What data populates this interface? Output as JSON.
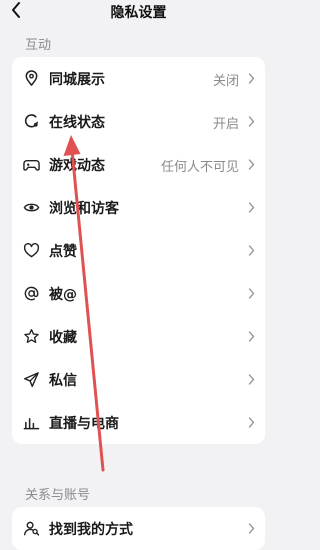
{
  "header": {
    "title": "隐私设置"
  },
  "sections": [
    {
      "title": "互动",
      "items": [
        {
          "label": "同城展示",
          "value": "关闭",
          "icon": "location-pin-icon"
        },
        {
          "label": "在线状态",
          "value": "开启",
          "icon": "online-status-icon"
        },
        {
          "label": "游戏动态",
          "value": "任何人不可见",
          "icon": "gamepad-icon"
        },
        {
          "label": "浏览和访客",
          "value": "",
          "icon": "eye-icon"
        },
        {
          "label": "点赞",
          "value": "",
          "icon": "heart-icon"
        },
        {
          "label": "被@",
          "value": "",
          "icon": "at-icon"
        },
        {
          "label": "收藏",
          "value": "",
          "icon": "star-icon"
        },
        {
          "label": "私信",
          "value": "",
          "icon": "send-icon"
        },
        {
          "label": "直播与电商",
          "value": "",
          "icon": "bar-chart-icon"
        }
      ]
    },
    {
      "title": "关系与账号",
      "items": [
        {
          "label": "找到我的方式",
          "value": "",
          "icon": "find-user-icon"
        }
      ]
    }
  ],
  "annotation": {
    "color": "#e05252",
    "icon": "red-arrow-annotation"
  }
}
